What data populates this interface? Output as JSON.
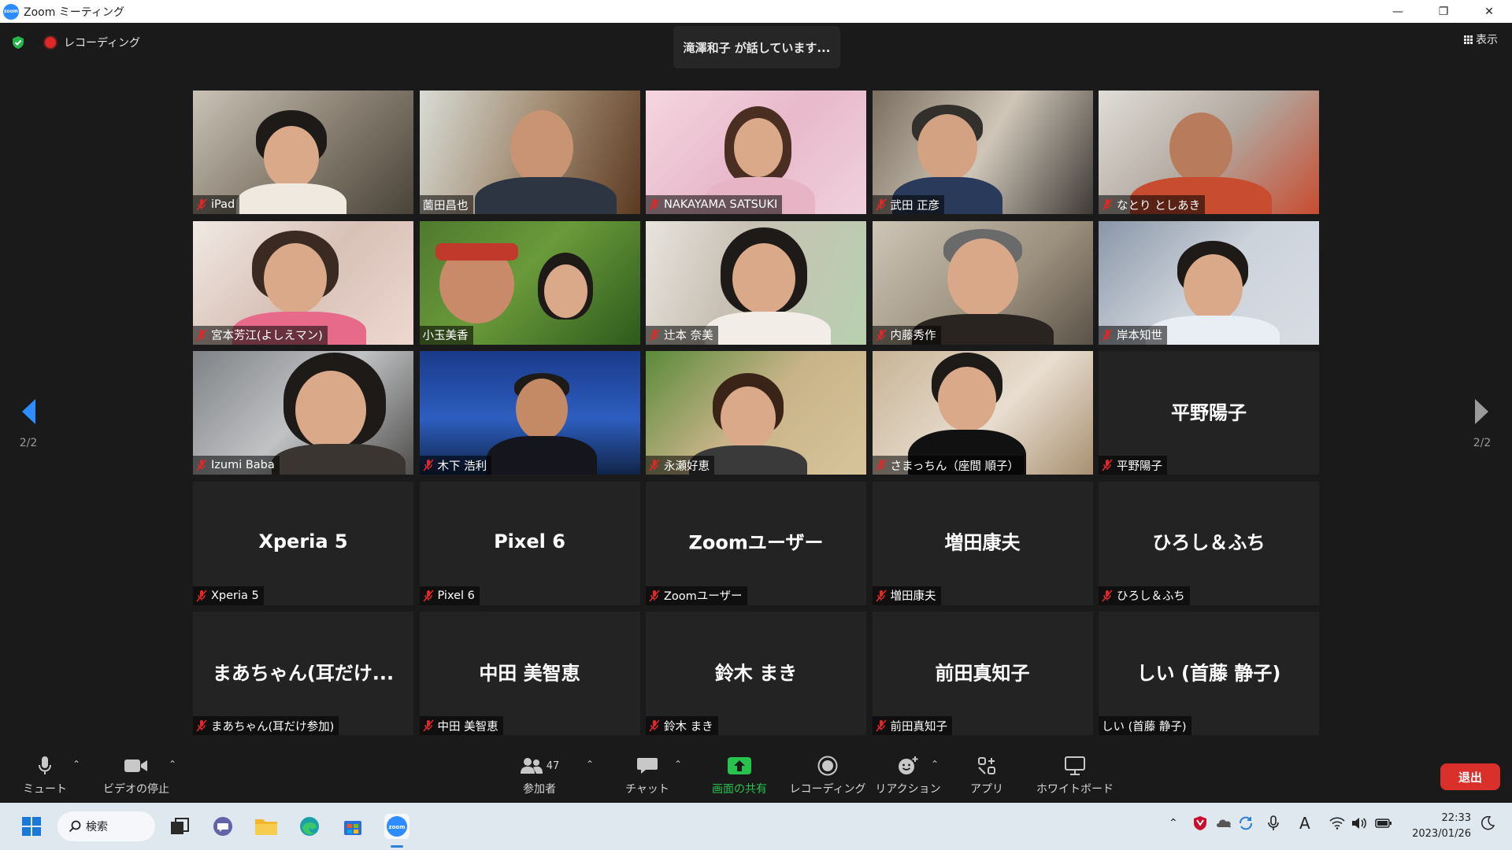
{
  "window": {
    "title": "Zoom ミーティング",
    "app_logo_text": "zoom",
    "minimize": "—",
    "restore": "❐",
    "close": "✕"
  },
  "status": {
    "recording_label": "レコーディング",
    "speaking_banner": "滝澤和子 が話しています...",
    "view_label": "表示"
  },
  "pager": {
    "page_indicator": "2/2"
  },
  "participants": [
    {
      "name": "iPad",
      "muted": true,
      "video": true
    },
    {
      "name": "薗田昌也",
      "muted": false,
      "video": true
    },
    {
      "name": "NAKAYAMA SATSUKI",
      "muted": true,
      "video": true
    },
    {
      "name": "武田 正彦",
      "muted": true,
      "video": true
    },
    {
      "name": "なとり としあき",
      "muted": true,
      "video": true
    },
    {
      "name": "宮本芳江(よしえマン)",
      "muted": true,
      "video": true
    },
    {
      "name": "小玉美香",
      "muted": false,
      "video": true
    },
    {
      "name": "辻本 奈美",
      "muted": true,
      "video": true
    },
    {
      "name": "内藤秀作",
      "muted": true,
      "video": true
    },
    {
      "name": "岸本知世",
      "muted": true,
      "video": true
    },
    {
      "name": "Izumi Baba",
      "muted": true,
      "video": true
    },
    {
      "name": "木下 浩利",
      "muted": true,
      "video": true
    },
    {
      "name": "永瀬好恵",
      "muted": true,
      "video": true
    },
    {
      "name": "さまっちん（座間 順子）",
      "muted": true,
      "video": true
    },
    {
      "name": "平野陽子",
      "display": "平野陽子",
      "muted": true,
      "video": false
    },
    {
      "name": "Xperia 5",
      "display": "Xperia 5",
      "muted": true,
      "video": false
    },
    {
      "name": "Pixel 6",
      "display": "Pixel 6",
      "muted": true,
      "video": false
    },
    {
      "name": "Zoomユーザー",
      "display": "Zoomユーザー",
      "muted": true,
      "video": false
    },
    {
      "name": "増田康夫",
      "display": "増田康夫",
      "muted": true,
      "video": false
    },
    {
      "name": "ひろし＆ふち",
      "display": "ひろし＆ふち",
      "muted": true,
      "video": false
    },
    {
      "name": "まあちゃん(耳だけ参加)",
      "display": "まあちゃん(耳だけ...",
      "muted": true,
      "video": false
    },
    {
      "name": "中田 美智恵",
      "display": "中田 美智恵",
      "muted": true,
      "video": false
    },
    {
      "name": "鈴木 まき",
      "display": "鈴木 まき",
      "muted": true,
      "video": false
    },
    {
      "name": "前田真知子",
      "display": "前田真知子",
      "muted": true,
      "video": false
    },
    {
      "name": "しい (首藤 静子)",
      "display": "しい (首藤 静子)",
      "muted": false,
      "video": false
    }
  ],
  "toolbar": {
    "mute": "ミュート",
    "stop_video": "ビデオの停止",
    "participants": "参加者",
    "participant_count": "47",
    "chat": "チャット",
    "share_screen": "画面の共有",
    "recording": "レコーディング",
    "reactions": "リアクション",
    "apps": "アプリ",
    "whiteboard": "ホワイトボード",
    "leave": "退出"
  },
  "taskbar": {
    "search": "検索",
    "time": "22:33",
    "date": "2023/01/26",
    "zoom_label": "zoom",
    "ime": "A"
  },
  "colors": {
    "accent_green": "#28c24e",
    "leave_red": "#d9302c",
    "mic_off_red": "#e02828",
    "zoom_blue": "#2d8cff"
  }
}
